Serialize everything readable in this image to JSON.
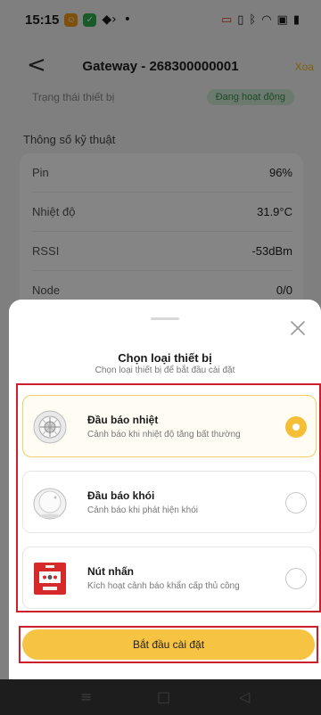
{
  "status_bar": {
    "time": "15:15",
    "left_icons": [
      "notification-app-icon",
      "shield-app-icon",
      "code-icon",
      "dot-icon"
    ],
    "right_icons": [
      "cast-icon",
      "vibrate-icon",
      "bluetooth-icon",
      "wifi-icon",
      "nfc-icon",
      "battery-icon"
    ]
  },
  "header": {
    "back_glyph": "<",
    "title": "Gateway - 268300000001",
    "action_label": "Xoa",
    "action_color": "#f0b928"
  },
  "background": {
    "status_label": "Trạng thái thiết bị",
    "status_value": "Đang hoạt động",
    "section_title": "Thông số kỹ thuật",
    "specs": [
      {
        "label": "Pin",
        "value": "96%"
      },
      {
        "label": "Nhiệt độ",
        "value": "31.9°C"
      },
      {
        "label": "RSSI",
        "value": "-53dBm"
      },
      {
        "label": "Node",
        "value": "0/0"
      }
    ]
  },
  "sheet": {
    "title": "Chọn loại thiết bị",
    "subtitle": "Chọn loại thiết bị để bắt đầu cài đặt",
    "options": [
      {
        "name": "Đầu báo nhiệt",
        "description": "Cảnh báo khi nhiệt độ tăng bất thường",
        "icon": "heat-detector-icon",
        "selected": true
      },
      {
        "name": "Đầu báo khói",
        "description": "Cảnh báo khi phát hiện khói",
        "icon": "smoke-detector-icon",
        "selected": false
      },
      {
        "name": "Nút nhấn",
        "description": "Kích hoạt cảnh báo khẩn cấp thủ công",
        "icon": "manual-call-point-icon",
        "selected": false
      }
    ],
    "confirm_label": "Bắt đầu cài đặt",
    "accent_color": "#f6c342",
    "highlight_color": "#cc1f2a"
  },
  "nav": {
    "icons": [
      "menu-icon",
      "home-icon",
      "back-icon"
    ]
  }
}
